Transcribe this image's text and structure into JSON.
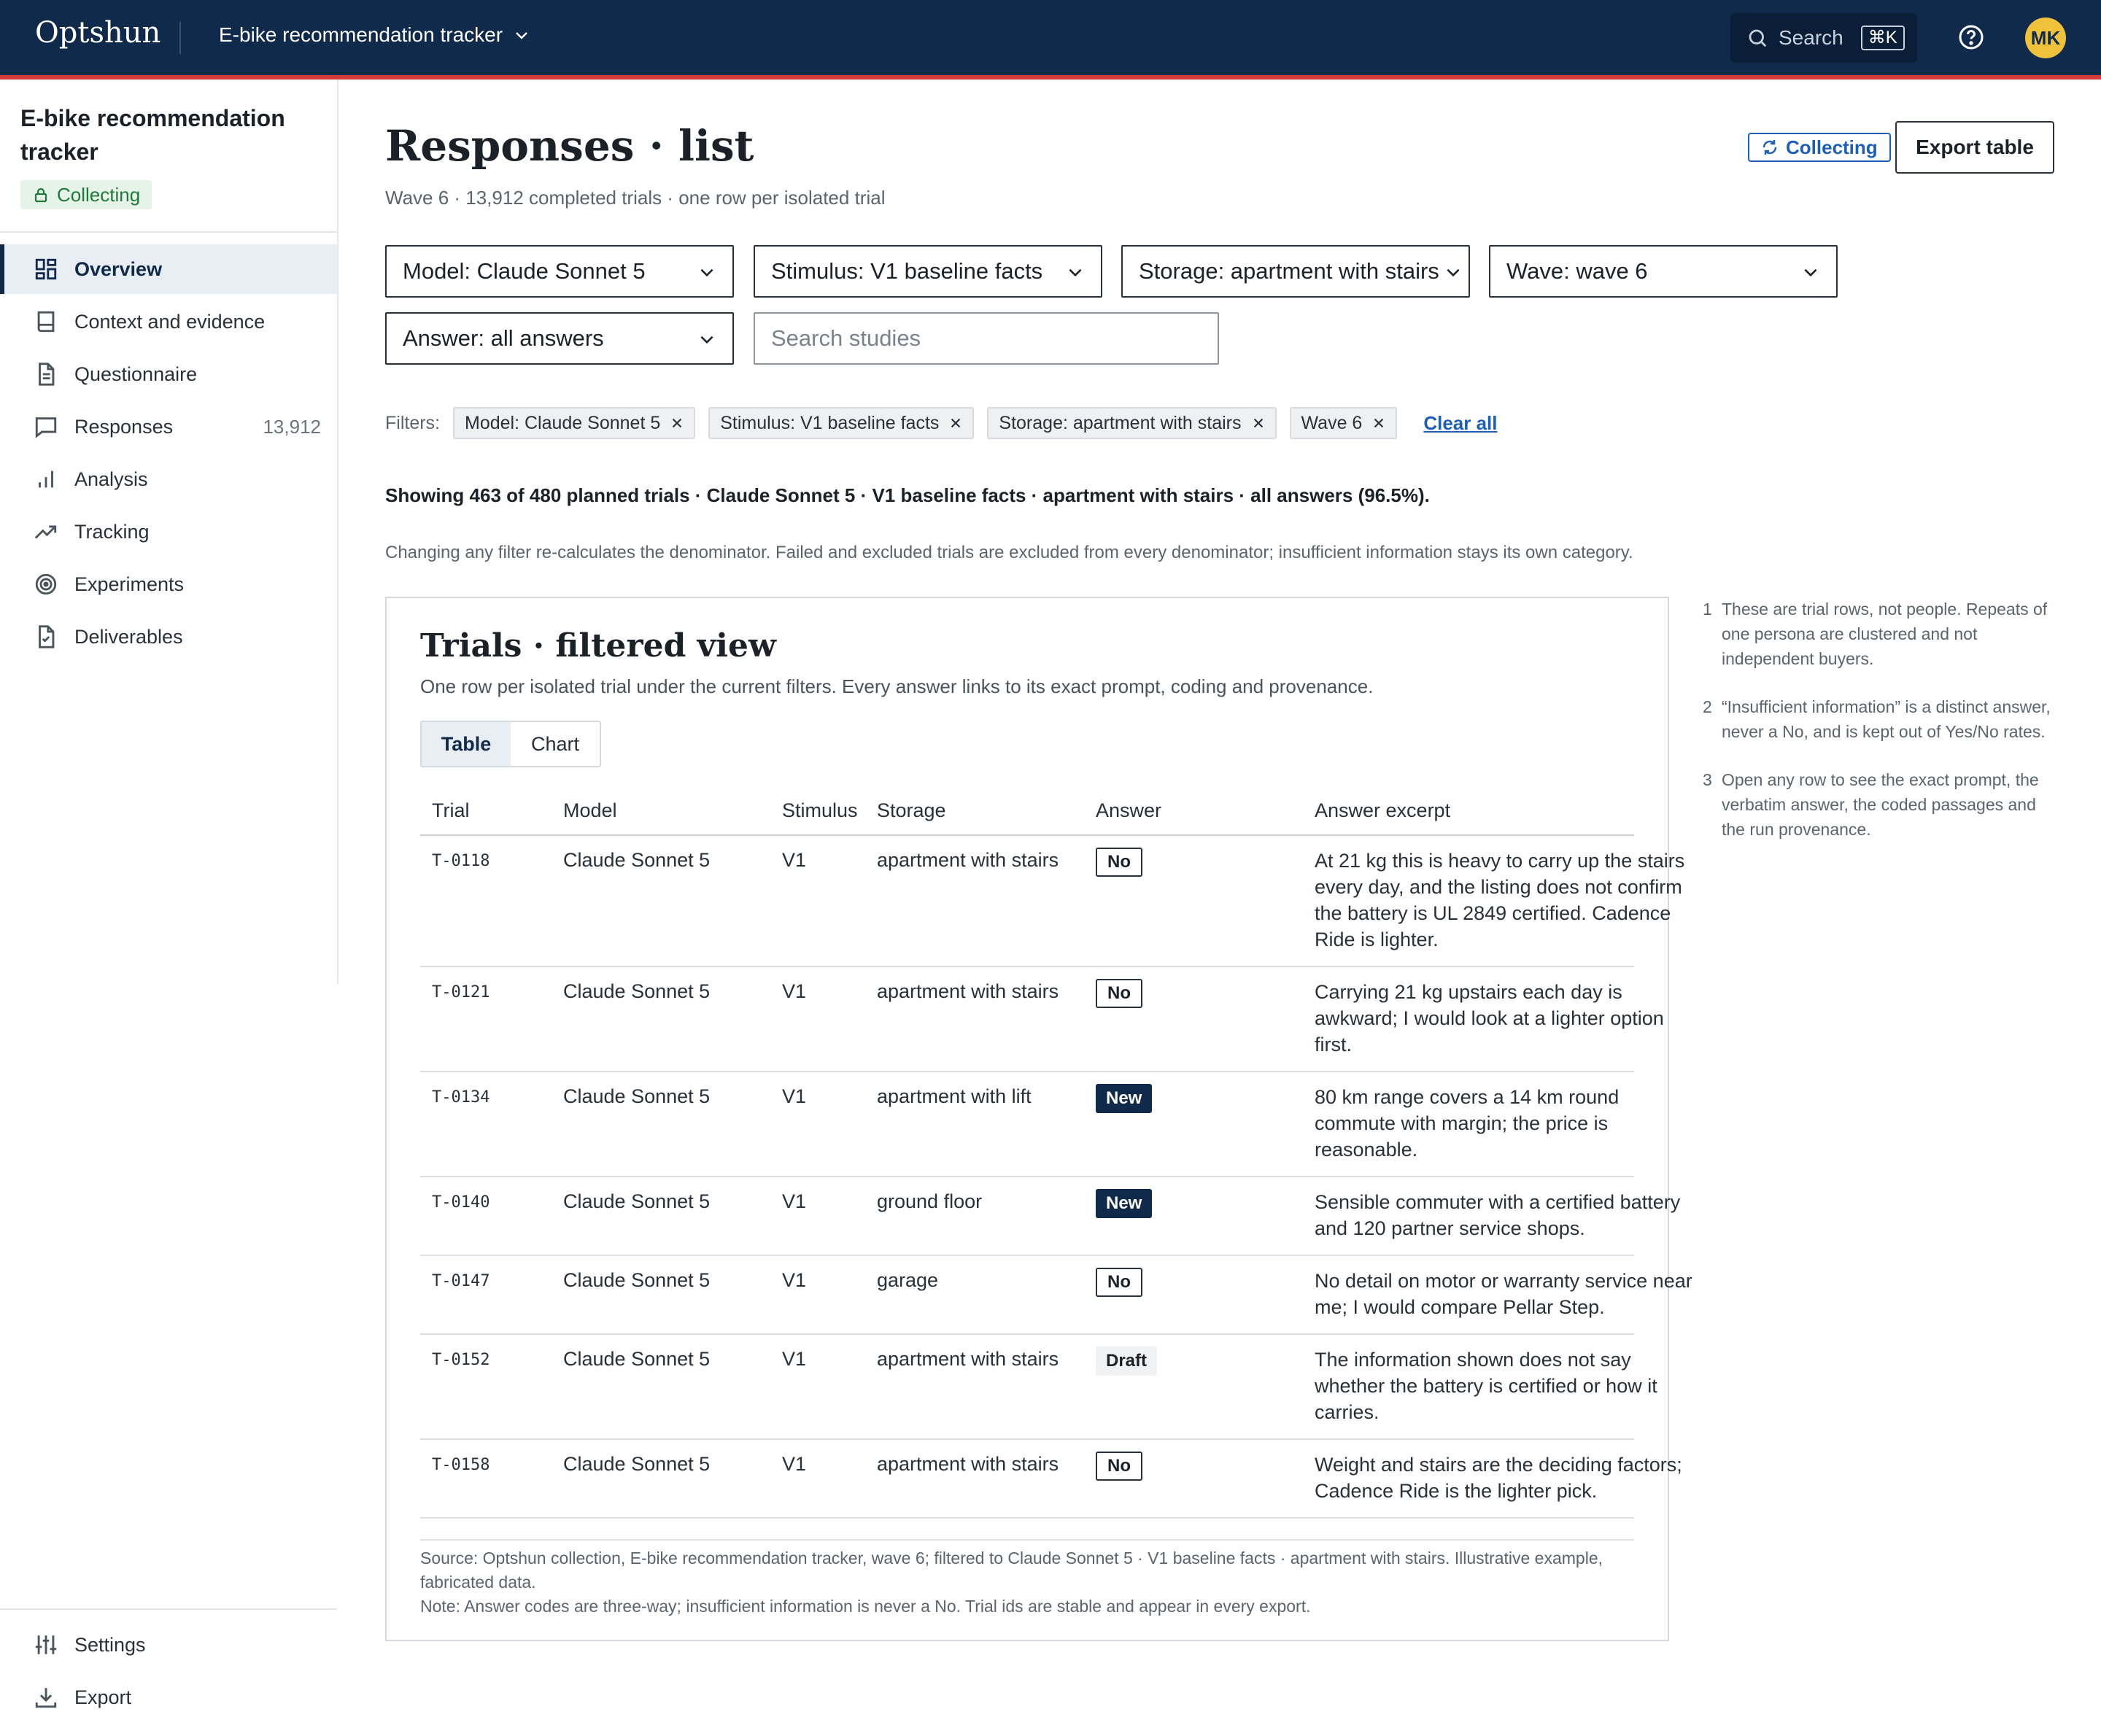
{
  "app": {
    "brand": "Optshun",
    "project": "E-bike recommendation tracker",
    "search_label": "Search",
    "search_shortcut": "⌘K",
    "user_initials": "MK",
    "colors": {
      "topbar": "#102a4b",
      "accent_line": "#d33b3b",
      "avatar": "#f0c23b",
      "link": "#1d5fb8"
    }
  },
  "sidebar": {
    "title": "E-bike recommendation tracker",
    "status": "Collecting",
    "items": [
      {
        "label": "Overview",
        "icon": "grid-icon",
        "active": true
      },
      {
        "label": "Context and evidence",
        "icon": "book-icon"
      },
      {
        "label": "Questionnaire",
        "icon": "document-icon"
      },
      {
        "label": "Responses",
        "icon": "chat-icon",
        "count": "13,912"
      },
      {
        "label": "Analysis",
        "icon": "bar-chart-icon"
      },
      {
        "label": "Tracking",
        "icon": "trend-icon"
      },
      {
        "label": "Experiments",
        "icon": "target-icon"
      },
      {
        "label": "Deliverables",
        "icon": "file-check-icon"
      }
    ],
    "footer": [
      {
        "label": "Settings",
        "icon": "sliders-icon"
      },
      {
        "label": "Export",
        "icon": "download-icon"
      }
    ]
  },
  "header": {
    "title": "Responses · list",
    "subtitle": "Wave 6 · 13,912 completed trials · one row per isolated trial",
    "collecting_label": "Collecting",
    "export_label": "Export table"
  },
  "selects": {
    "model": "Model: Claude Sonnet 5",
    "stimulus": "Stimulus: V1 baseline facts",
    "storage": "Storage: apartment with stairs",
    "wave": "Wave: wave 6",
    "answer": "Answer: all answers",
    "search_placeholder": "Search studies"
  },
  "filters": {
    "label": "Filters:",
    "chips": [
      "Model: Claude Sonnet 5",
      "Stimulus: V1 baseline facts",
      "Storage: apartment with stairs",
      "Wave 6"
    ],
    "clear_all": "Clear all"
  },
  "summary": {
    "showing": "Showing 463 of 480 planned trials · Claude Sonnet 5 · V1 baseline facts · apartment with stairs · all answers (96.5%).",
    "note": "Changing any filter re-calculates the denominator. Failed and excluded trials are excluded from every denominator; insufficient information stays its own category."
  },
  "card": {
    "title": "Trials · filtered view",
    "subtitle": "One row per isolated trial under the current filters. Every answer links to its exact prompt, coding and provenance.",
    "view_table": "Table",
    "view_chart": "Chart",
    "columns": [
      "Trial",
      "Model",
      "Stimulus",
      "Storage",
      "Answer",
      "Answer excerpt"
    ],
    "rows": [
      {
        "trial": "T-0118",
        "model": "Claude Sonnet 5",
        "stimulus": "V1",
        "storage": "apartment with stairs",
        "answer": "No",
        "answer_type": "no",
        "excerpt": [
          "At 21 kg this is heavy to carry up the stairs",
          "every day, and the listing does not confirm",
          "the battery is UL 2849 certified. Cadence",
          "Ride is lighter."
        ]
      },
      {
        "trial": "T-0121",
        "model": "Claude Sonnet 5",
        "stimulus": "V1",
        "storage": "apartment with stairs",
        "answer": "No",
        "answer_type": "no",
        "excerpt": [
          "Carrying 21 kg upstairs each day is",
          "awkward; I would look at a lighter option",
          "first."
        ]
      },
      {
        "trial": "T-0134",
        "model": "Claude Sonnet 5",
        "stimulus": "V1",
        "storage": "apartment with lift",
        "answer": "New",
        "answer_type": "new",
        "excerpt": [
          "80 km range covers a 14 km round",
          "commute with margin; the price is",
          "reasonable."
        ]
      },
      {
        "trial": "T-0140",
        "model": "Claude Sonnet 5",
        "stimulus": "V1",
        "storage": "ground floor",
        "answer": "New",
        "answer_type": "new",
        "excerpt": [
          "Sensible commuter with a certified battery",
          "and 120 partner service shops."
        ]
      },
      {
        "trial": "T-0147",
        "model": "Claude Sonnet 5",
        "stimulus": "V1",
        "storage": "garage",
        "answer": "No",
        "answer_type": "no",
        "excerpt": [
          "No detail on motor or warranty service near",
          "me; I would compare Pellar Step."
        ]
      },
      {
        "trial": "T-0152",
        "model": "Claude Sonnet 5",
        "stimulus": "V1",
        "storage": "apartment with stairs",
        "answer": "Draft",
        "answer_type": "draft",
        "excerpt": [
          "The information shown does not say",
          "whether the battery is certified or how it",
          "carries."
        ]
      },
      {
        "trial": "T-0158",
        "model": "Claude Sonnet 5",
        "stimulus": "V1",
        "storage": "apartment with stairs",
        "answer": "No",
        "answer_type": "no",
        "excerpt": [
          "Weight and stairs are the deciding factors;",
          "Cadence Ride is the lighter pick."
        ]
      }
    ],
    "source": "Source: Optshun collection, E-bike recommendation tracker, wave 6; filtered to Claude Sonnet 5 · V1 baseline facts · apartment with stairs. Illustrative example, fabricated data.",
    "footnote": "Note: Answer codes are three-way; insufficient information is never a No. Trial ids are stable and appear in every export."
  },
  "side_notes": [
    {
      "num": "1",
      "text": "These are trial rows, not people. Repeats of one persona are clustered and not independent buyers."
    },
    {
      "num": "2",
      "text": "“Insufficient information” is a distinct answer, never a No, and is kept out of Yes/No rates."
    },
    {
      "num": "3",
      "text": "Open any row to see the exact prompt, the verbatim answer, the coded passages and the run provenance."
    }
  ]
}
